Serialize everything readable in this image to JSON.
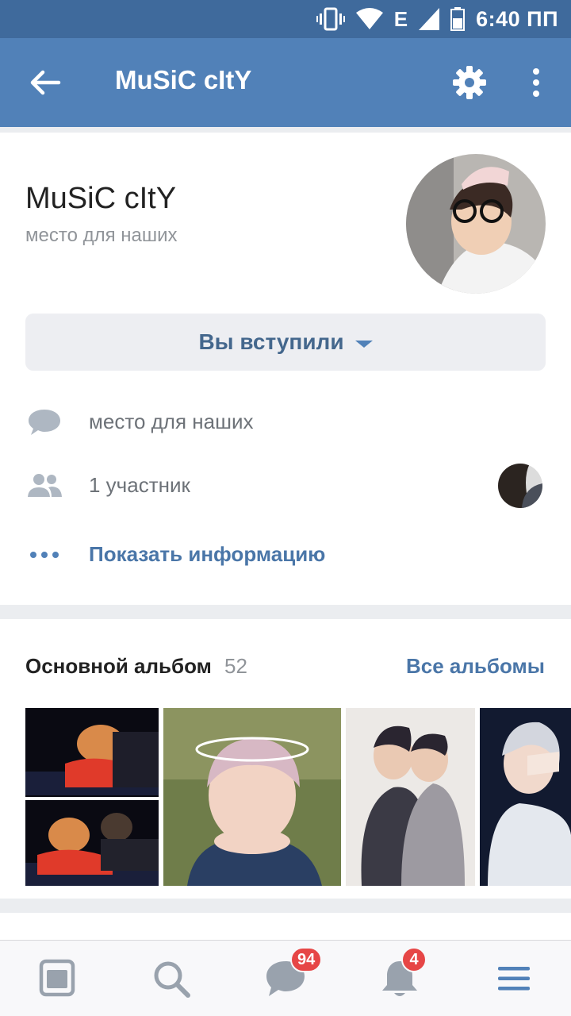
{
  "status_bar": {
    "time": "6:40 ПП",
    "network": "E",
    "icons": [
      "vibrate-icon",
      "wifi-icon",
      "signal-icon",
      "battery-icon"
    ]
  },
  "app_bar": {
    "title": "MuSiC cItY",
    "icons": [
      "back-arrow-icon",
      "gear-icon",
      "more-vert-icon"
    ]
  },
  "group": {
    "name": "MuSiC cItY",
    "status": "место для наших",
    "joined_button_label": "Вы вступили"
  },
  "info": {
    "description": "место для наших",
    "members": "1 участник",
    "show_info_label": "Показать информацию"
  },
  "album": {
    "title": "Основной альбом",
    "count": "52",
    "all_albums_label": "Все альбомы"
  },
  "bottom_nav": {
    "items": [
      {
        "name": "news",
        "icon": "news-icon"
      },
      {
        "name": "search",
        "icon": "search-icon"
      },
      {
        "name": "messages",
        "icon": "messages-icon",
        "badge": "94"
      },
      {
        "name": "notifications",
        "icon": "bell-icon",
        "badge": "4"
      },
      {
        "name": "menu",
        "icon": "menu-icon"
      }
    ]
  },
  "colors": {
    "header": "#5181b8",
    "status_bar": "#3f6a9c",
    "link": "#4a76a8",
    "badge": "#e64646"
  }
}
